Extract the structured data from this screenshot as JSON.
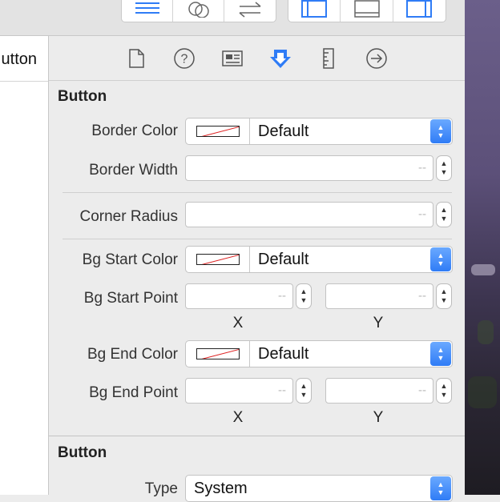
{
  "left_panel": {
    "item_label": "utton"
  },
  "toolbar": {
    "icons": [
      "align-left-icon",
      "venn-icon",
      "swap-arrows-icon",
      "left-panel-icon",
      "bottom-panel-icon",
      "right-panel-icon"
    ]
  },
  "inspector_tabs": [
    "file-icon",
    "help-icon",
    "identity-icon",
    "attributes-icon",
    "ruler-icon",
    "connections-icon"
  ],
  "section1": {
    "title": "Button",
    "border_color": {
      "label": "Border Color",
      "value": "Default"
    },
    "border_width": {
      "label": "Border Width",
      "value": "--"
    },
    "corner_radius": {
      "label": "Corner Radius",
      "value": "--"
    },
    "bg_start_color": {
      "label": "Bg Start Color",
      "value": "Default"
    },
    "bg_start_point": {
      "label": "Bg Start Point",
      "x_value": "--",
      "y_value": "--",
      "x_label": "X",
      "y_label": "Y"
    },
    "bg_end_color": {
      "label": "Bg End Color",
      "value": "Default"
    },
    "bg_end_point": {
      "label": "Bg End Point",
      "x_value": "--",
      "y_value": "--",
      "x_label": "X",
      "y_label": "Y"
    }
  },
  "section2": {
    "title": "Button",
    "type": {
      "label": "Type",
      "value": "System"
    }
  },
  "colors": {
    "accent": "#2f7cf6",
    "selected_tab": "#2f7cf6",
    "panel": "#ececec"
  }
}
